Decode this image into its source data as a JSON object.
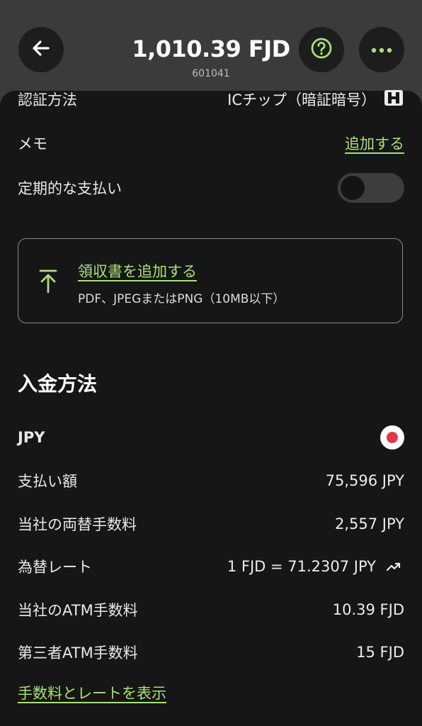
{
  "header": {
    "amount": "1,010.39 FJD",
    "sub_id": "601041"
  },
  "details": {
    "auth_method": {
      "label": "認証方法",
      "value": "ICチップ（暗証暗号）"
    },
    "memo": {
      "label": "メモ",
      "action": "追加する"
    },
    "recurring": {
      "label": "定期的な支払い",
      "enabled": false
    }
  },
  "receipt": {
    "title": "領収書を追加する",
    "subtitle": "PDF、JPEGまたはPNG（10MB以下）"
  },
  "funding": {
    "title": "入金方法",
    "currency": "JPY",
    "rows": [
      {
        "label": "支払い額",
        "value": "75,596 JPY"
      },
      {
        "label": "当社の両替手数料",
        "value": "2,557 JPY"
      },
      {
        "label": "為替レート",
        "value": "1 FJD = 71.2307 JPY"
      },
      {
        "label": "当社のATM手数料",
        "value": "10.39 FJD"
      },
      {
        "label": "第三者ATM手数料",
        "value": "15 FJD"
      }
    ],
    "show_link": "手数料とレートを表示"
  },
  "icons": {
    "back": "arrow-left-icon",
    "help": "question-circle-icon",
    "more": "more-horizontal-icon",
    "card": "card-chip-icon",
    "upload": "upload-arrow-icon",
    "flag": "japan-flag-icon",
    "trend": "trend-up-icon"
  },
  "colors": {
    "accent": "#a8e07a",
    "background": "#161616",
    "header": "#3b3b3b"
  }
}
